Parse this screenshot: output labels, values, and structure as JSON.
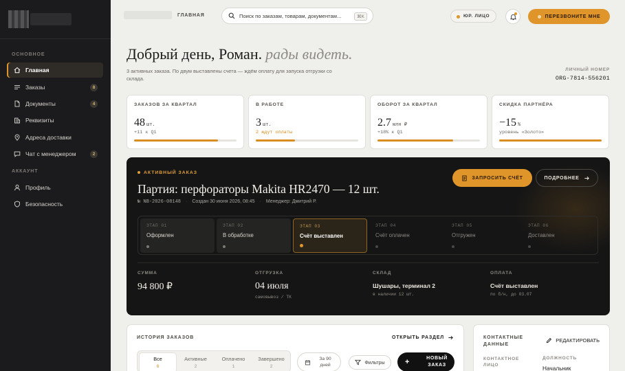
{
  "sidebar": {
    "section_main": "ОСНОВНОЕ",
    "items": [
      {
        "label": "Главная",
        "icon": "home-icon",
        "badge": ""
      },
      {
        "label": "Заказы",
        "icon": "list-icon",
        "badge": "8"
      },
      {
        "label": "Документы",
        "icon": "document-icon",
        "badge": "4"
      },
      {
        "label": "Реквизиты",
        "icon": "building-icon",
        "badge": ""
      },
      {
        "label": "Адреса доставки",
        "icon": "location-pin-icon",
        "badge": ""
      },
      {
        "label": "Чат с менеджером",
        "icon": "chat-icon",
        "badge": "2"
      }
    ],
    "section_account": "АККАУНТ",
    "account_items": [
      {
        "label": "Профиль",
        "icon": "user-icon"
      },
      {
        "label": "Безопасность",
        "icon": "shield-icon"
      }
    ]
  },
  "header": {
    "breadcrumb": "ГЛАВНАЯ",
    "search_placeholder": "Поиск по заказам, товарам, документам...",
    "search_shortcut": "⌘K",
    "entity_label": "ЮР. ЛИЦО",
    "cta_label": "ПЕРЕЗВОНИТЕ МНЕ"
  },
  "greeting": {
    "title": "Добрый день, Роман.",
    "accent": "рады видеть.",
    "subtitle": "3 активных заказа. По двум выставлены счета — ждём оплату для запуска отгрузки со склада.",
    "org_label": "ЛИЧНЫЙ НОМЕР",
    "org_value": "ORG-7814-556201"
  },
  "stats": [
    {
      "label": "ЗАКАЗОВ ЗА КВАРТАЛ",
      "value": "48",
      "unit": "шт.",
      "delta": "+11 к Q1",
      "warn": false,
      "progress": 0.82
    },
    {
      "label": "В РАБОТЕ",
      "value": "3",
      "unit": "шт.",
      "delta": "2 ждут оплаты",
      "warn": true,
      "progress": 0.38
    },
    {
      "label": "ОБОРОТ ЗА КВАРТАЛ",
      "value": "2.7",
      "unit": "млн ₽",
      "delta": "+18% к Q1",
      "warn": false,
      "progress": 0.74
    },
    {
      "label": "СКИДКА ПАРТНЁРА",
      "value": "−15",
      "unit": "%",
      "delta": "уровень «Золото»",
      "warn": false,
      "progress": 1.0
    }
  ],
  "order": {
    "tag": "АКТИВНЫЙ ЗАКАЗ",
    "title": "Партия: перфораторы Makita HR2470 — 12 шт.",
    "number": "№ NB-2026-08148",
    "created": "Создан 30 июня 2026, 08:45",
    "manager": "Менеджер: Дмитрий Р.",
    "btn_invoice": "ЗАПРОСИТЬ СЧЁТ",
    "btn_more": "ПОДРОБНЕЕ",
    "stages": [
      {
        "num": "ЭТАП 01",
        "name": "Оформлен",
        "state": "done"
      },
      {
        "num": "ЭТАП 02",
        "name": "В обработке",
        "state": "done"
      },
      {
        "num": "ЭТАП 03",
        "name": "Счёт выставлен",
        "state": "current"
      },
      {
        "num": "ЭТАП 04",
        "name": "Счёт оплачен",
        "state": "todo"
      },
      {
        "num": "ЭТАП 05",
        "name": "Отгружен",
        "state": "todo"
      },
      {
        "num": "ЭТАП 06",
        "name": "Доставлен",
        "state": "todo"
      }
    ],
    "info": [
      {
        "label": "СУММА",
        "value": "94 800 ₽",
        "hint": ""
      },
      {
        "label": "ОТГРУЗКА",
        "value": "04 июля",
        "hint": "самовывоз / ТК"
      },
      {
        "label": "СКЛАД",
        "value": "Шушары, терминал 2",
        "hint": "в наличии 12 шт."
      },
      {
        "label": "ОПЛАТА",
        "value": "Счёт выставлен",
        "hint": "по б/н, до 03.07"
      }
    ]
  },
  "history": {
    "title": "ИСТОРИЯ ЗАКАЗОВ",
    "open_label": "ОТКРЫТЬ РАЗДЕЛ",
    "tabs": [
      {
        "label": "Все",
        "count": "6"
      },
      {
        "label": "Активные",
        "count": "2"
      },
      {
        "label": "Оплачено",
        "count": "1"
      },
      {
        "label": "Завершено",
        "count": "2"
      }
    ],
    "date_filter": "За 90 дней",
    "filters_label": "Фильтры",
    "new_order_label": "НОВЫЙ ЗАКАЗ"
  },
  "contacts": {
    "title": "КОНТАКТНЫЕ ДАННЫЕ",
    "edit_label": "РЕДАКТИРОВАТЬ",
    "contact_label": "КОНТАКТНОЕ ЛИЦО",
    "position_label": "ДОЛЖНОСТЬ",
    "position_value": "Начальник"
  },
  "colors": {
    "accent": "#e0952a",
    "sidebar_bg": "#1b1b1d",
    "card_dark": "#151515",
    "page_bg": "#efefec"
  }
}
